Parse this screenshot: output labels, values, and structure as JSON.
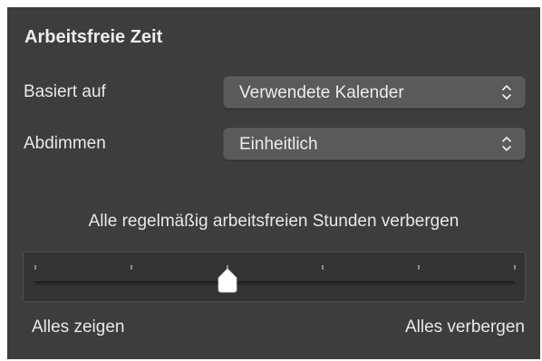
{
  "panel": {
    "title": "Arbeitsfreie Zeit"
  },
  "rows": [
    {
      "label": "Basiert auf",
      "value": "Verwendete Kalender",
      "icon": "chevron-updown-icon"
    },
    {
      "label": "Abdimmen",
      "value": "Einheitlich",
      "icon": "chevron-updown-icon"
    }
  ],
  "slider": {
    "caption": "Alle regelmäßig arbeitsfreien Stunden verbergen",
    "min_label": "Alles zeigen",
    "max_label": "Alles verbergen",
    "tick_count": 6,
    "value": 0.4
  },
  "colors": {
    "panel_bg": "#3d3d3d",
    "popup_bg": "#5a5a5a",
    "text": "#e8e8e8",
    "thumb": "#ffffff"
  }
}
